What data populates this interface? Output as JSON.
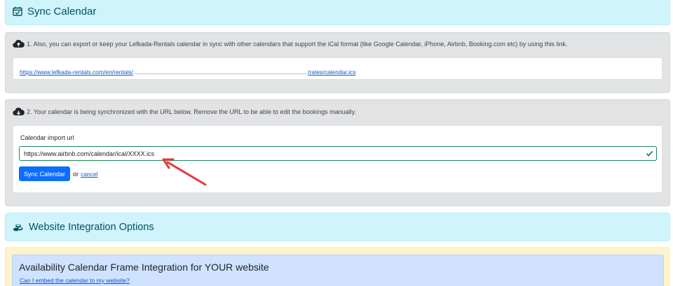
{
  "sync_section": {
    "title": "Sync Calendar",
    "icon": "calendar-check-icon"
  },
  "export_panel": {
    "icon": "cloud-upload-icon",
    "text": "1. Also, you can export or keep your Lefkada-Rentals calendar in sync with other calendars that support the iCal format (like Google Calendar, iPhone, Airbnb, Booking.com etc) by using this link.",
    "link_start": "https://www.lefkada-rentals.com/en/rentals/",
    "link_end": "/rates/calendar.ics"
  },
  "import_panel": {
    "icon": "cloud-download-icon",
    "text": "2. Your calendar is being synchronized with the URL below. Remove the URL to be able to edit the bookings manually.",
    "field_label": "Calendar import url",
    "field_value": "https://www.airbnb.com/calendar/ical/XXXX.ics",
    "sync_button": "Sync Calendar",
    "or_text": "or",
    "cancel_link": "cancel"
  },
  "website_section": {
    "title": "Website Integration Options",
    "icon": "coins-icon"
  },
  "frame_integration": {
    "title": "Availability Calendar Frame Integration for YOUR website",
    "help_link": "Can I embed the calendar to my website?"
  },
  "colors": {
    "info_bg": "#cff4fc",
    "info_text": "#055160",
    "primary": "#0d6efd",
    "success": "#198754",
    "arrow": "#e03a3a"
  }
}
